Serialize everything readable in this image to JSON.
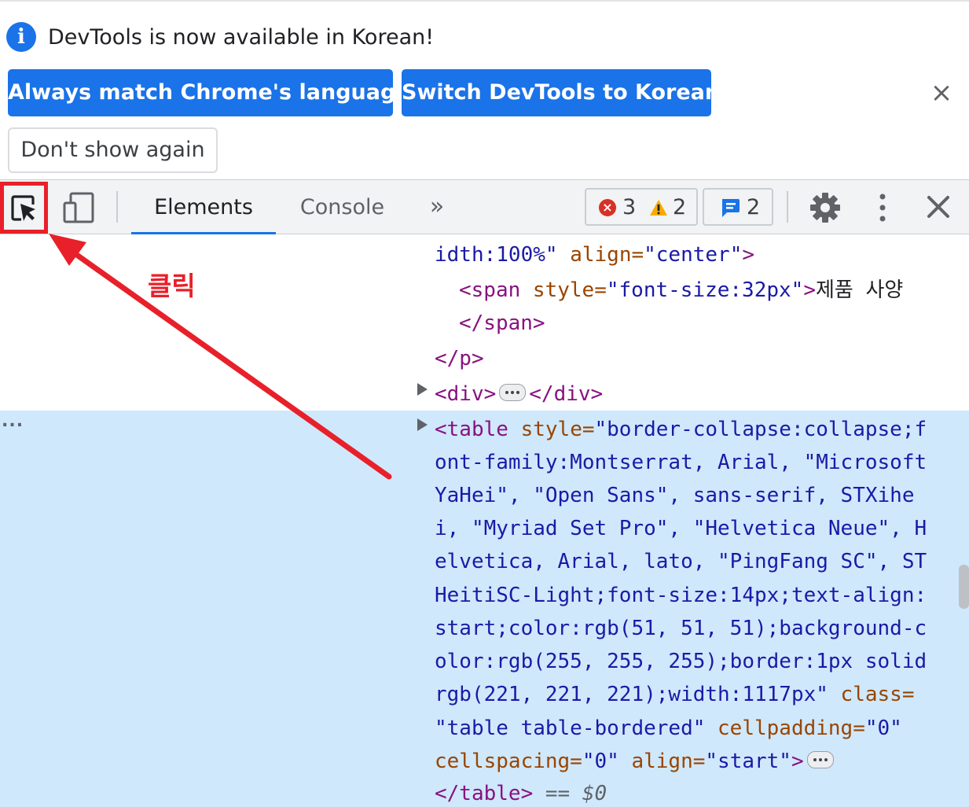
{
  "infobar": {
    "message": "DevTools is now available in Korean!",
    "primary_buttons": [
      "Always match Chrome's language",
      "Switch DevTools to Korean"
    ],
    "secondary_button": "Don't show again",
    "close_glyph": "×",
    "info_glyph": "i"
  },
  "toolbar": {
    "tabs": [
      "Elements",
      "Console"
    ],
    "active_tab": "Elements",
    "more_tabs_glyph": "»",
    "error_count": "3",
    "warning_count": "2",
    "message_count": "2",
    "error_glyph": "×",
    "close_glyph": "×",
    "icons": [
      "inspect-element-icon",
      "device-toggle-icon",
      "gear-icon",
      "kebab-menu-icon",
      "close-icon"
    ]
  },
  "annotation": {
    "label": "클릭",
    "color": "#e8202a"
  },
  "elements_panel": {
    "left_dots": "...",
    "line1": {
      "pre": "idth:100%\"",
      "attr": " align=",
      "val": "\"center\"",
      "tag_close": ">"
    },
    "line2": {
      "tag_open": "<span",
      "attr": " style=",
      "val": "\"font-size:32px\"",
      "tag_close": ">",
      "text": "제품 사양"
    },
    "line3": "</span>",
    "line4": "</p>",
    "line5": {
      "open": "<div>",
      "close": "</div>"
    },
    "table_lines": [
      {
        "tag": "<table",
        "attr": " style=",
        "val": "\"border-collapse:collapse;f"
      },
      {
        "val": "ont-family:Montserrat, Arial, \"Microsoft"
      },
      {
        "val": "YaHei\", \"Open Sans\", sans-serif, STXihe"
      },
      {
        "val": "i, \"Myriad Set Pro\", \"Helvetica Neue\", H"
      },
      {
        "val": "elvetica, Arial, lato, \"PingFang SC\", ST"
      },
      {
        "val": "HeitiSC-Light;font-size:14px;text-align:"
      },
      {
        "val": "start;color:rgb(51, 51, 51);background-c"
      },
      {
        "val": "olor:rgb(255, 255, 255);border:1px solid"
      },
      {
        "val": "rgb(221, 221, 221);width:1117px\"",
        "attr": " class="
      },
      {
        "val": "\"table table-bordered\"",
        "attr": " cellpadding=",
        "val2": "\"0\""
      },
      {
        "attr": "cellspacing=",
        "val": "\"0\"",
        "attr2": " align=",
        "val2": "\"start\"",
        "tag_close": ">"
      },
      {
        "tag": "</table>",
        "muted": " == ",
        "ref": "$0"
      }
    ]
  },
  "colors": {
    "accent": "#1a73e8",
    "tag": "#881280",
    "attribute": "#994500",
    "value": "#1a1aa6",
    "selection": "#cfe8fc",
    "error": "#d93025",
    "warning": "#f29900"
  }
}
